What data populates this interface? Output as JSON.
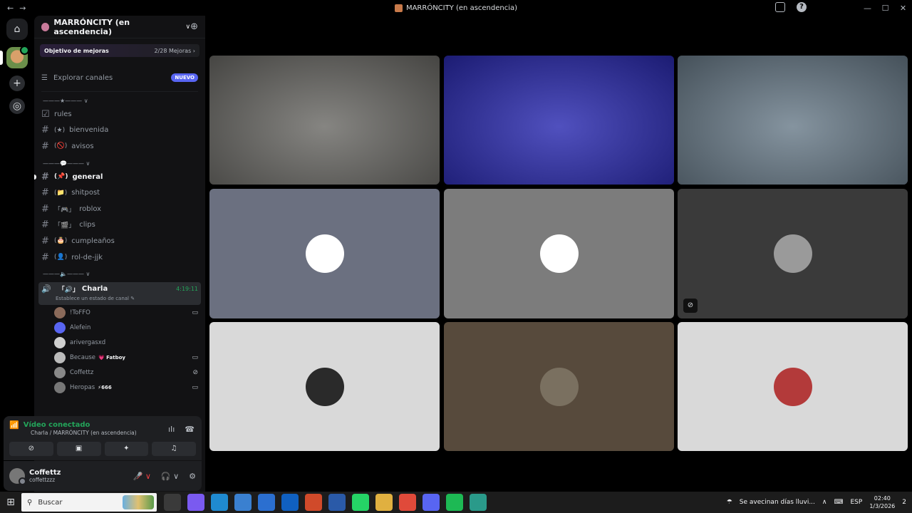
{
  "window": {
    "title": "MARRÓNCITY (en ascendencia)",
    "nav_back": "←",
    "nav_forward": "→",
    "help_glyph": "?",
    "minimize": "—",
    "maximize": "☐",
    "close": "✕"
  },
  "rail": {
    "discord_glyph": "⌂",
    "add_glyph": "+",
    "discover_glyph": "◎"
  },
  "server": {
    "name": "MARRÓNCITY (en ascendencia)",
    "chevron": "∨",
    "invite_glyph": "⊕",
    "boost_goal": "Objetivo de mejoras",
    "boost_count": "2/28 Mejoras ›",
    "explore_label": "Explorar canales",
    "explore_badge": "NUEVO"
  },
  "categories": {
    "cat1": "———★——— ∨",
    "cat2": "———💬——— ∨",
    "cat3": "———🔈——— ∨"
  },
  "channels": {
    "rules": "rules",
    "bienvenida": "bienvenida",
    "avisos": "avisos",
    "general": "general",
    "shitpost": "shitpost",
    "roblox": "roblox",
    "clips": "clips",
    "cumpleanos": "cumpleaños",
    "rol": "rol-de-jjk",
    "emoji_bienvenida": "(★)",
    "emoji_avisos": "(🚫)",
    "emoji_general": "(📌)",
    "emoji_shitpost": "(📁)",
    "emoji_roblox": "「🎮」",
    "emoji_clips": "「🎬」",
    "emoji_cumple": "(🎂)",
    "emoji_rol": "(👤)"
  },
  "voice_channel": {
    "emoji": "「🔊」",
    "name": "Charla",
    "timer": "4:19:11",
    "status": "Establece un estado de canal ✎"
  },
  "voice_users": [
    {
      "name": "!ToFFO",
      "tag": "",
      "camera": true,
      "muted": false
    },
    {
      "name": "Alefein",
      "tag": "",
      "camera": false,
      "muted": false
    },
    {
      "name": "arivergasxd",
      "tag": "",
      "camera": false,
      "muted": false
    },
    {
      "name": "Because",
      "tag": "💗 Fatboy",
      "camera": true,
      "muted": false
    },
    {
      "name": "Coffettz",
      "tag": "",
      "camera": false,
      "muted": true
    },
    {
      "name": "Heropas",
      "tag": "⚡666",
      "camera": true,
      "muted": false
    }
  ],
  "voice_icons": {
    "camera": "▭",
    "muted": "⊘"
  },
  "connection": {
    "status": "Vídeo conectado",
    "location": "Charla / MARRÓNCITY (en ascendencia)",
    "signal_glyph": "📶",
    "noise_glyph": "ıIı",
    "disconnect_glyph": "☎",
    "btn_camera": "⊘",
    "btn_screen": "▣",
    "btn_activity": "✦",
    "btn_soundboard": "♫"
  },
  "user": {
    "display_name": "Coffettz",
    "username": "coffettzzz",
    "mic_glyph": "🎤̸ ∨",
    "headset_glyph": "🎧 ∨",
    "settings_glyph": "⚙"
  },
  "video_tiles": [
    {
      "kind": "camera",
      "bg": "#6b6a66"
    },
    {
      "kind": "camera",
      "bg": "#2a2ab0"
    },
    {
      "kind": "camera",
      "bg": "#6a7c8a"
    },
    {
      "kind": "avatar",
      "bg": "#6b7080",
      "avatar_color": "#ffffff"
    },
    {
      "kind": "avatar",
      "bg": "#7c7c7c",
      "avatar_color": "#ffffff"
    },
    {
      "kind": "avatar",
      "bg": "#3a3a3a",
      "avatar_color": "#9a9a9a",
      "muted": true
    },
    {
      "kind": "avatar",
      "bg": "#d9d9d9",
      "avatar_color": "#2a2a2a"
    },
    {
      "kind": "avatar",
      "bg": "#574a3c",
      "avatar_color": "#7a7060"
    },
    {
      "kind": "avatar",
      "bg": "#d9d9d9",
      "avatar_color": "#b33a3a"
    }
  ],
  "taskbar": {
    "search_placeholder": "Buscar",
    "start_glyph": "⊞",
    "search_glyph": "⚲",
    "weather": "Se avecinan días lluvi...",
    "tray_up": "∧",
    "keyboard_glyph": "⌨",
    "lang": "ESP",
    "time": "02:40",
    "date": "1/3/2026",
    "notifications": "2",
    "apps": [
      "task-view",
      "copilot",
      "edge",
      "store",
      "planner",
      "outlook",
      "powerpoint",
      "word",
      "whatsapp",
      "explorer",
      "chrome",
      "discord",
      "spotify",
      "app"
    ]
  }
}
